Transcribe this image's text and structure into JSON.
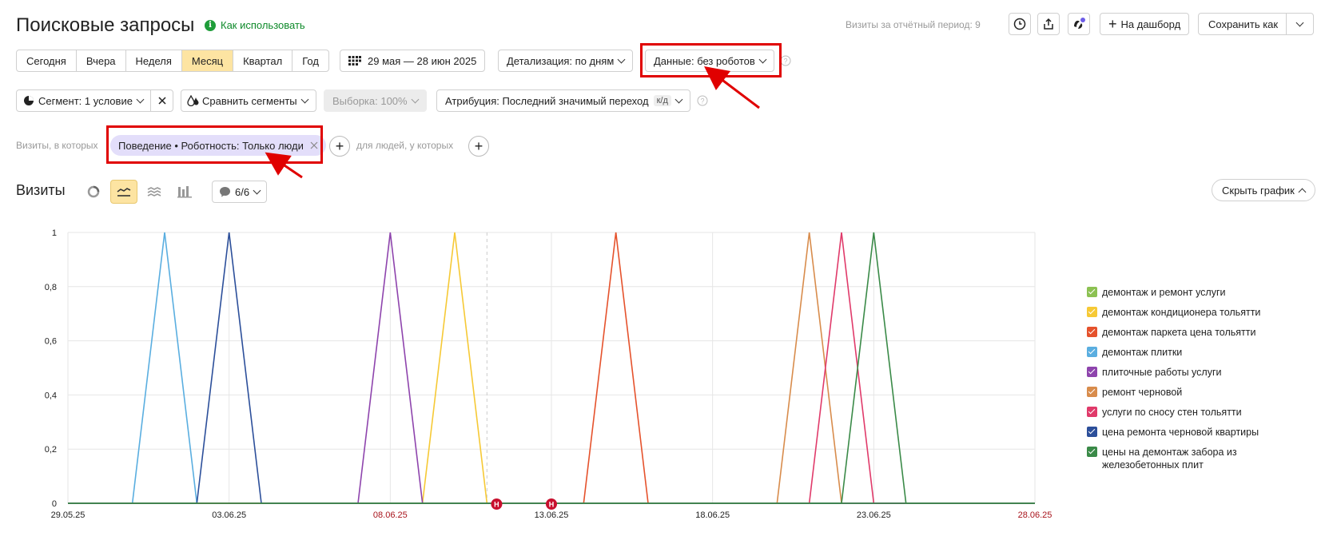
{
  "header": {
    "title": "Поисковые запросы",
    "howto": "Как использовать",
    "visits_period": "Визиты за отчётный период: 9",
    "to_dashboard": "На дашборд",
    "save_as": "Сохранить как"
  },
  "periods": [
    "Сегодня",
    "Вчера",
    "Неделя",
    "Месяц",
    "Квартал",
    "Год"
  ],
  "active_period": "Месяц",
  "date_range": "29 мая — 28 июн 2025",
  "detail": "Детализация: по дням",
  "data_filter": "Данные: без роботов",
  "segment": "Сегмент: 1 условие",
  "compare": "Сравнить сегменты",
  "sample": "Выборка: 100%",
  "attribution": "Атрибуция: Последний значимый переход",
  "attribution_badge": "к/д",
  "filters": {
    "visits_label": "Визиты, в которых",
    "chip": "Поведение • Роботность: Только люди",
    "people_label": "для людей, у которых"
  },
  "section": {
    "title": "Визиты",
    "series_count": "6/6",
    "hide_chart": "Скрыть график"
  },
  "colors": {
    "accent_yellow": "#fde4a2",
    "highlight_red": "#e00000",
    "link_green": "#0e8a2a"
  },
  "chart_data": {
    "type": "line",
    "x": [
      "29.05.25",
      "30.05.25",
      "31.05.25",
      "01.06.25",
      "02.06.25",
      "03.06.25",
      "04.06.25",
      "05.06.25",
      "06.06.25",
      "07.06.25",
      "08.06.25",
      "09.06.25",
      "10.06.25",
      "11.06.25",
      "12.06.25",
      "13.06.25",
      "14.06.25",
      "15.06.25",
      "16.06.25",
      "17.06.25",
      "18.06.25",
      "19.06.25",
      "20.06.25",
      "21.06.25",
      "22.06.25",
      "23.06.25",
      "24.06.25",
      "25.06.25",
      "26.06.25",
      "27.06.25",
      "28.06.25"
    ],
    "x_tick_labels": [
      "29.05.25",
      "03.06.25",
      "08.06.25",
      "13.06.25",
      "18.06.25",
      "23.06.25",
      "28.06.25"
    ],
    "weekend_ticks": [
      "08.06.25",
      "28.06.25"
    ],
    "y_ticks": [
      "0",
      "0,2",
      "0,4",
      "0,6",
      "0,8",
      "1"
    ],
    "ylim": [
      0,
      1
    ],
    "annotations": [
      "Н",
      "Н"
    ],
    "annotation_dates": [
      "12.06.25",
      "13.06.25"
    ],
    "grid": true,
    "legend_position": "right",
    "series": [
      {
        "name": "демонтаж и ремонт услуги",
        "color": "#8cc152",
        "peak": null
      },
      {
        "name": "демонтаж кондиционера тольятти",
        "color": "#f6c935",
        "peak": "10.06.25"
      },
      {
        "name": "демонтаж паркета цена тольятти",
        "color": "#e5522c",
        "peak": "15.06.25"
      },
      {
        "name": "демонтаж плитки",
        "color": "#5aaee0",
        "peak": "01.06.25"
      },
      {
        "name": "плиточные работы услуги",
        "color": "#8e44ad",
        "peak": "08.06.25"
      },
      {
        "name": "ремонт черновой",
        "color": "#d88c4c",
        "peak": "21.06.25"
      },
      {
        "name": "услуги по сносу стен тольятти",
        "color": "#e03a6a",
        "peak": "22.06.25"
      },
      {
        "name": "цена ремонта черновой квартиры",
        "color": "#2c4f9a",
        "peak": "03.06.25"
      },
      {
        "name": "цены на демонтаж забора из железобетонных плит",
        "color": "#3a8a48",
        "peak": "23.06.25"
      }
    ]
  }
}
